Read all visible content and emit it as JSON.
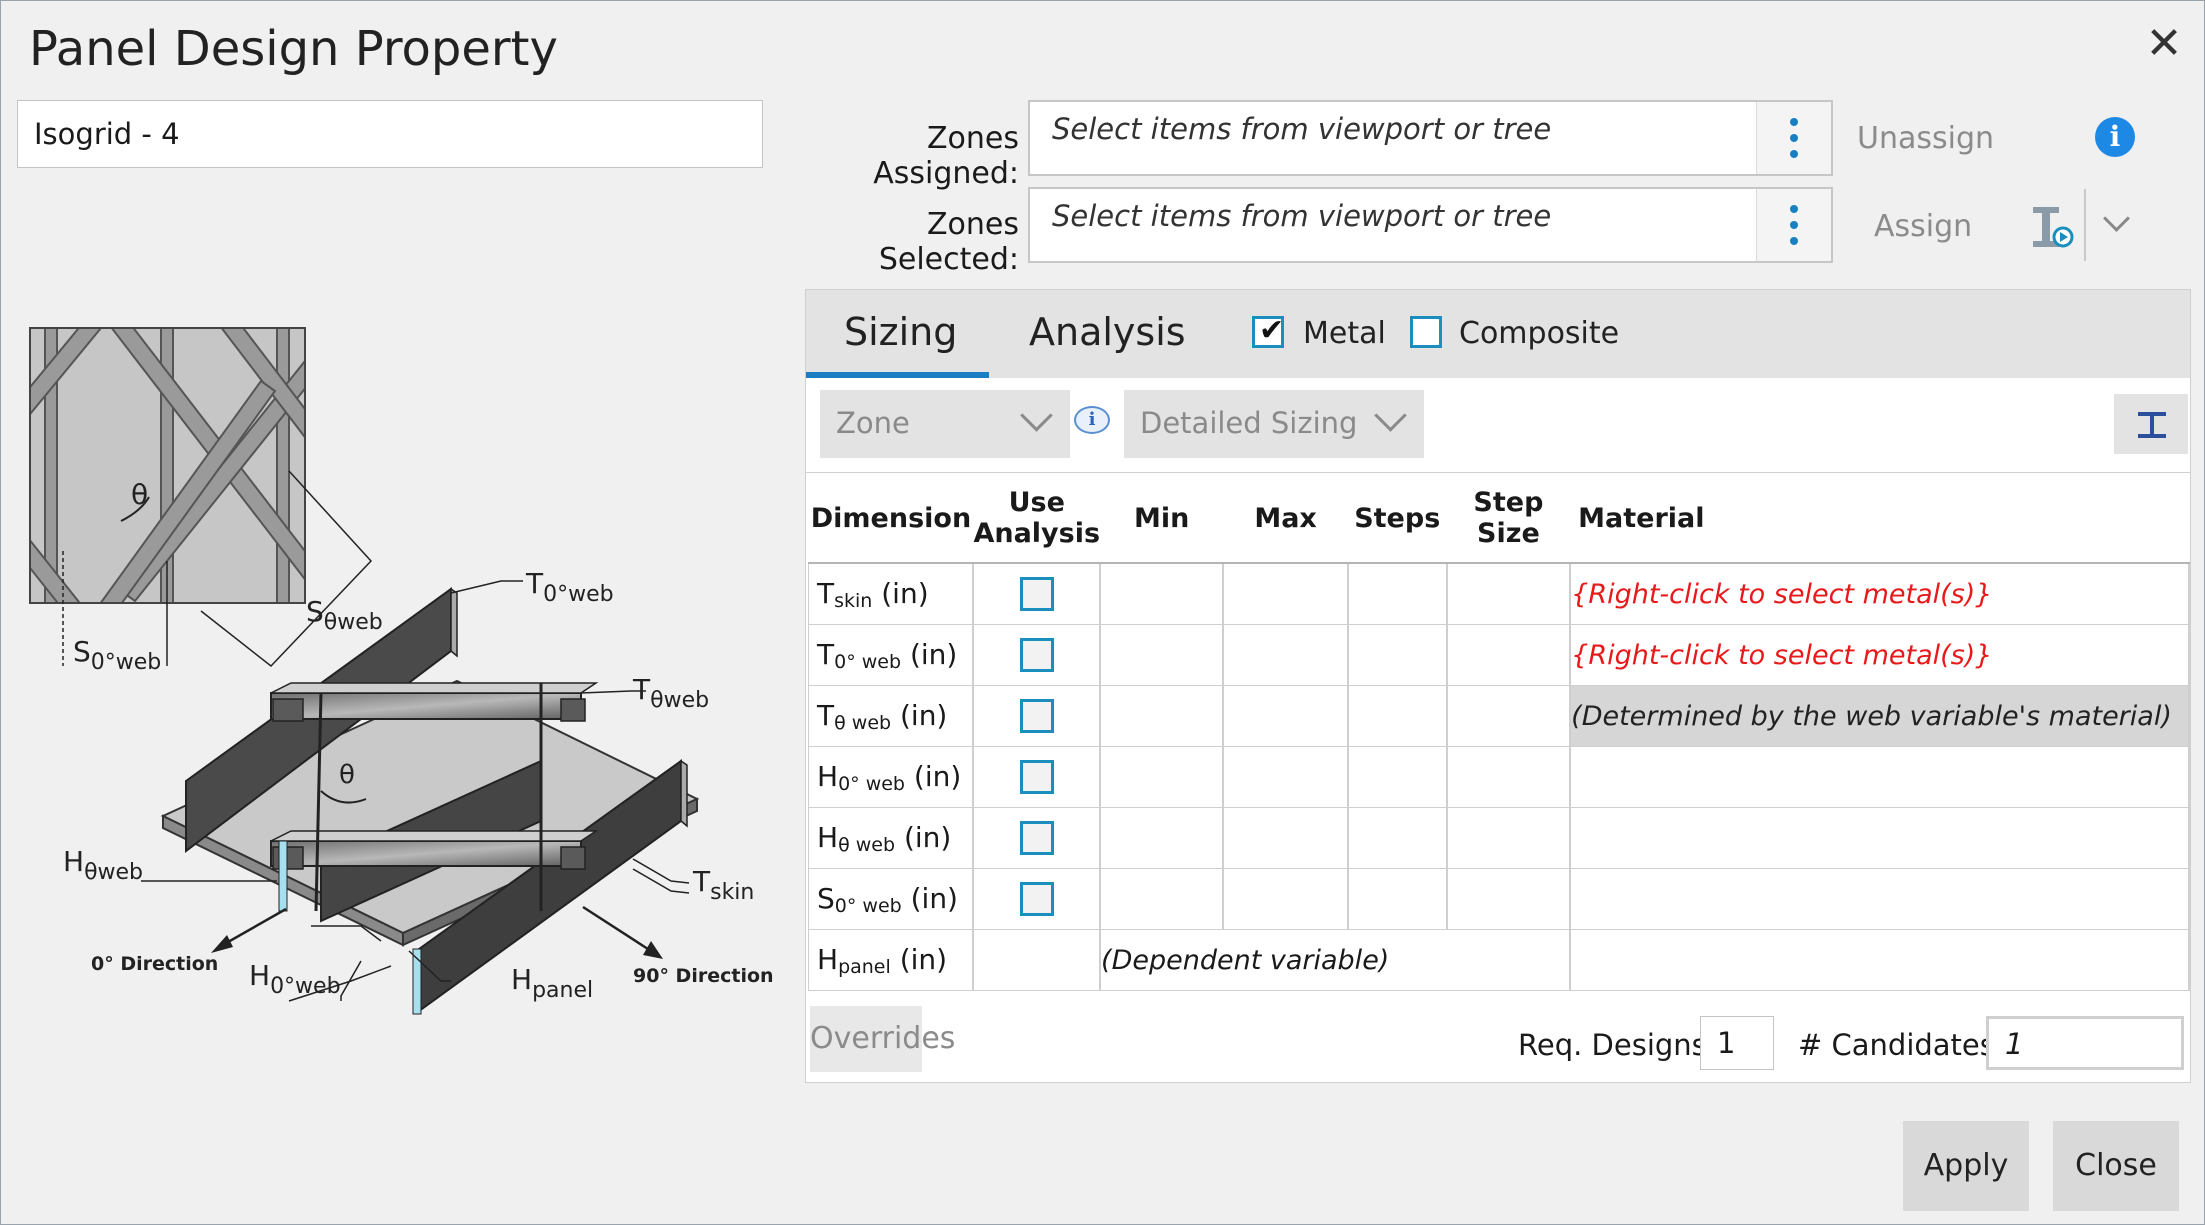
{
  "window": {
    "title": "Panel Design Property"
  },
  "property_name": "Isogrid - 4",
  "zones": {
    "assigned_label": "Zones Assigned:",
    "selected_label": "Zones Selected:",
    "placeholder": "Select items from viewport or tree",
    "unassign": "Unassign",
    "assign": "Assign"
  },
  "diagram": {
    "theta": "θ",
    "s_theta_web": {
      "main": "S",
      "sub": "θweb"
    },
    "s_0_web": {
      "main": "S",
      "sub": "0°web"
    },
    "t_0_web": {
      "main": "T",
      "sub": "0°web"
    },
    "t_theta_web": {
      "main": "T",
      "sub": "θweb"
    },
    "h_theta_web": {
      "main": "H",
      "sub": "θweb"
    },
    "t_skin": {
      "main": "T",
      "sub": "skin"
    },
    "h_0_web": {
      "main": "H",
      "sub": "0°web"
    },
    "h_panel": {
      "main": "H",
      "sub": "panel"
    },
    "dir_0": "0° Direction",
    "dir_90": "90° Direction"
  },
  "tabs": [
    {
      "label": "Sizing",
      "active": true
    },
    {
      "label": "Analysis",
      "active": false
    }
  ],
  "material_types": [
    {
      "label": "Metal",
      "checked": true
    },
    {
      "label": "Composite",
      "checked": false
    }
  ],
  "filters": {
    "zone": "Zone",
    "sizing_mode": "Detailed Sizing"
  },
  "table": {
    "headers": {
      "dimension": "Dimension",
      "use": "Use",
      "analysis": "Analysis",
      "min": "Min",
      "max": "Max",
      "steps": "Steps",
      "step": "Step",
      "size": "Size",
      "material": "Material"
    },
    "rows": [
      {
        "main": "T",
        "sub": "skin",
        "unit": "(in)",
        "material": "{Right-click to select metal(s)}"
      },
      {
        "main": "T",
        "sub": "0° web",
        "unit": "(in)",
        "material": "{Right-click to select metal(s)}"
      },
      {
        "main": "T",
        "sub": "θ web",
        "unit": "(in)",
        "material": "(Determined by the web variable's material)"
      },
      {
        "main": "H",
        "sub": "0° web",
        "unit": "(in)",
        "material": ""
      },
      {
        "main": "H",
        "sub": "θ web",
        "unit": "(in)",
        "material": ""
      },
      {
        "main": "S",
        "sub": "0° web",
        "unit": "(in)",
        "material": ""
      },
      {
        "main": "H",
        "sub": "panel",
        "unit": "(in)",
        "dependent": "(Dependent variable)"
      }
    ]
  },
  "footer": {
    "overrides": "Overrides",
    "req_designs_label": "Req. Designs",
    "req_designs": "1",
    "candidates_label": "# Candidates",
    "candidates": "1"
  },
  "buttons": {
    "apply": "Apply",
    "close": "Close"
  },
  "colors": {
    "accent": "#1a7fc2",
    "checkbox": "#1a8fbd",
    "warning_text": "#e8191a",
    "info": "#1e88e5"
  }
}
